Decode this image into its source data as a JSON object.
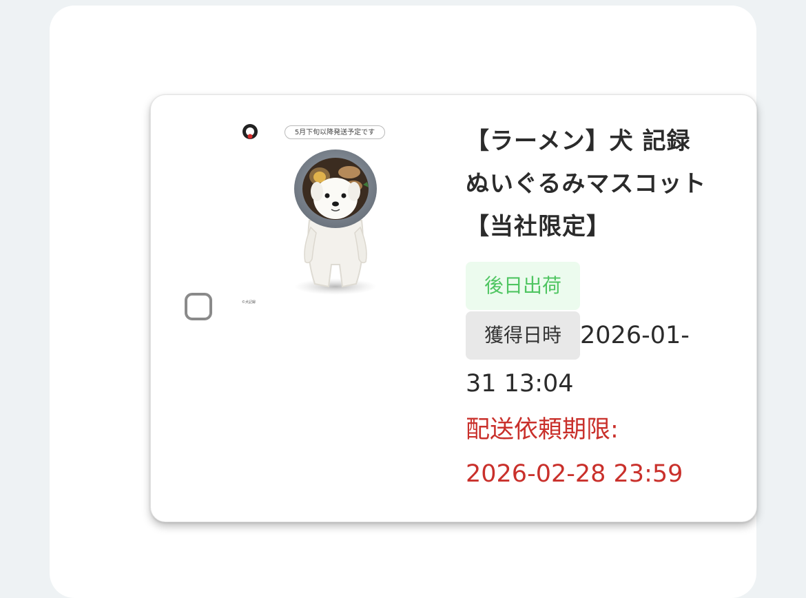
{
  "item": {
    "title": "【ラーメン】犬 記録　ぬいぐるみマスコット【当社限定】",
    "ship_status": "後日出荷",
    "acquired_label": "獲得日時",
    "acquired_value": "2026-01-31 13:04",
    "deadline_label": "配送依頼期限:",
    "deadline_value": "2026-02-28 23:59",
    "image": {
      "ship_note": "5月下旬以降発送予定です",
      "copyright": "©犬記録"
    }
  },
  "colors": {
    "ship_badge_bg": "#ecfbee",
    "ship_badge_text": "#4fc561",
    "deadline_text": "#c9302b",
    "label_bg": "#e8e8e8"
  },
  "icons": [
    "checkbox-icon",
    "brand-logo-icon"
  ]
}
